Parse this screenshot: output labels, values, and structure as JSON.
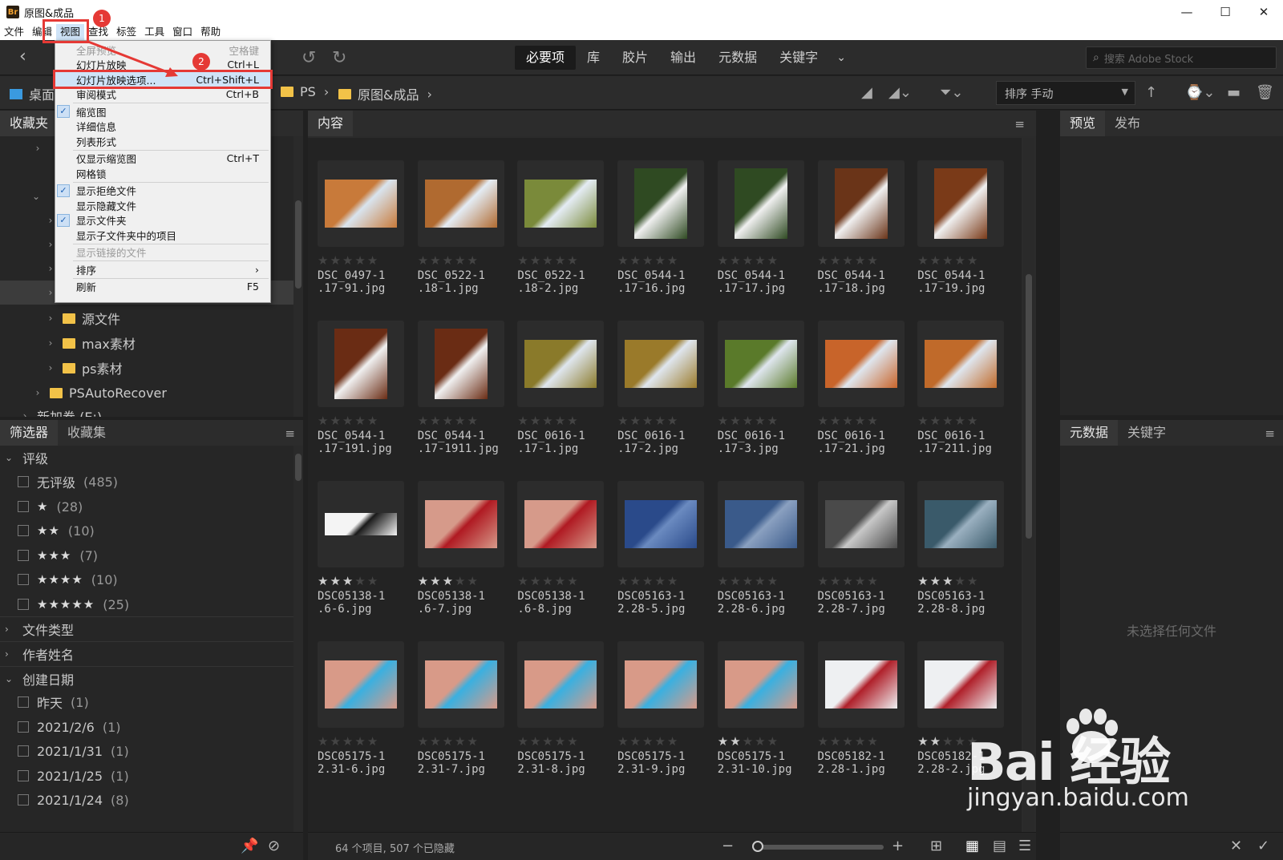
{
  "window": {
    "logo": "Br",
    "title": "原图&成品",
    "controls": [
      "—",
      "☐",
      "✕"
    ]
  },
  "menubar": [
    "文件",
    "编辑",
    "视图",
    "查找",
    "标签",
    "工具",
    "窗口",
    "帮助"
  ],
  "toolbar": {
    "workspaces": [
      "必要项",
      "库",
      "胶片",
      "输出",
      "元数据",
      "关键字"
    ],
    "more": "⌄",
    "search_placeholder": "搜索 Adobe Stock"
  },
  "path": {
    "desktop": "桌面",
    "ps": "PS",
    "current": "原图&成品",
    "sort_label": "排序 手动"
  },
  "left_top": {
    "tabs": [
      "收藏夹"
    ],
    "folders": [
      {
        "label": "源文件",
        "chev": "›",
        "indent": 56
      },
      {
        "label": "max素材",
        "chev": "›",
        "indent": 56
      },
      {
        "label": "ps素材",
        "chev": "›",
        "indent": 56
      },
      {
        "label": "PSAutoRecover",
        "chev": "›",
        "indent": 40
      },
      {
        "label": "新加卷 (E:)",
        "chev": "›",
        "indent": 24
      }
    ]
  },
  "filter": {
    "tabs": [
      "筛选器",
      "收藏集"
    ],
    "sections": {
      "rating": "评级",
      "file_type": "文件类型",
      "author": "作者姓名",
      "created": "创建日期"
    },
    "ratings": [
      {
        "label": "无评级",
        "count": "(485)"
      },
      {
        "stars": "★",
        "count": "(28)"
      },
      {
        "stars": "★★",
        "count": "(10)"
      },
      {
        "stars": "★★★",
        "count": "(7)"
      },
      {
        "stars": "★★★★",
        "count": "(10)"
      },
      {
        "stars": "★★★★★",
        "count": "(25)"
      }
    ],
    "dates": [
      {
        "label": "昨天",
        "count": "(1)"
      },
      {
        "label": "2021/2/6",
        "count": "(1)"
      },
      {
        "label": "2021/1/31",
        "count": "(1)"
      },
      {
        "label": "2021/1/25",
        "count": "(1)"
      },
      {
        "label": "2021/1/24",
        "count": "(8)"
      }
    ]
  },
  "content": {
    "tab": "内容",
    "items": [
      {
        "name": "DSC_0497-1\n.17-91.jpg",
        "rating": 0,
        "c1": "#c87a3a",
        "c2": "#d9e4ee",
        "shape": "wide"
      },
      {
        "name": "DSC_0522-1\n.18-1.jpg",
        "rating": 0,
        "c1": "#b06a30",
        "c2": "#e4ecf4",
        "shape": "wide"
      },
      {
        "name": "DSC_0522-1\n.18-2.jpg",
        "rating": 0,
        "c1": "#7a8a3a",
        "c2": "#e4ecf4",
        "shape": "wide"
      },
      {
        "name": "DSC_0544-1\n.17-16.jpg",
        "rating": 0,
        "c1": "#2f4a22",
        "c2": "#f0f0f0",
        "shape": "tall"
      },
      {
        "name": "DSC_0544-1\n.17-17.jpg",
        "rating": 0,
        "c1": "#2f4a22",
        "c2": "#f0f0f0",
        "shape": "tall"
      },
      {
        "name": "DSC_0544-1\n.17-18.jpg",
        "rating": 0,
        "c1": "#6a3418",
        "c2": "#f0f0f0",
        "shape": "tall"
      },
      {
        "name": "DSC_0544-1\n.17-19.jpg",
        "rating": 0,
        "c1": "#7a3a18",
        "c2": "#f0f0f0",
        "shape": "tall"
      },
      {
        "name": "DSC_0544-1\n.17-191.jpg",
        "rating": 0,
        "c1": "#6a2c14",
        "c2": "#f0f0f0",
        "shape": "tall"
      },
      {
        "name": "DSC_0544-1\n.17-1911.jpg",
        "rating": 0,
        "c1": "#6a2c14",
        "c2": "#f0f0f0",
        "shape": "tall"
      },
      {
        "name": "DSC_0616-1\n.17-1.jpg",
        "rating": 0,
        "c1": "#8a7a2a",
        "c2": "#dfe6ee",
        "shape": "wide"
      },
      {
        "name": "DSC_0616-1\n.17-2.jpg",
        "rating": 0,
        "c1": "#9a7a2a",
        "c2": "#dfe6ee",
        "shape": "wide"
      },
      {
        "name": "DSC_0616-1\n.17-3.jpg",
        "rating": 0,
        "c1": "#5a7a2a",
        "c2": "#dfe6ee",
        "shape": "wide"
      },
      {
        "name": "DSC_0616-1\n.17-21.jpg",
        "rating": 0,
        "c1": "#c8642a",
        "c2": "#dfe6ee",
        "shape": "wide"
      },
      {
        "name": "DSC_0616-1\n.17-211.jpg",
        "rating": 0,
        "c1": "#c06a2a",
        "c2": "#dfe6ee",
        "shape": "wide"
      },
      {
        "name": "DSC05138-1\n.6-6.jpg",
        "rating": 3,
        "c1": "#f4f4f4",
        "c2": "#1a1a1a",
        "shape": "banner"
      },
      {
        "name": "DSC05138-1\n.6-7.jpg",
        "rating": 3,
        "c1": "#d69a8a",
        "c2": "#b01a22",
        "shape": "wide"
      },
      {
        "name": "DSC05138-1\n.6-8.jpg",
        "rating": 0,
        "c1": "#d69a8a",
        "c2": "#b01a22",
        "shape": "wide"
      },
      {
        "name": "DSC05163-1\n2.28-5.jpg",
        "rating": 0,
        "c1": "#2a4a8a",
        "c2": "#6a8ac0",
        "shape": "wide"
      },
      {
        "name": "DSC05163-1\n2.28-6.jpg",
        "rating": 0,
        "c1": "#3a5a8a",
        "c2": "#8aa0c0",
        "shape": "wide"
      },
      {
        "name": "DSC05163-1\n2.28-7.jpg",
        "rating": 0,
        "c1": "#4a4a4a",
        "c2": "#c8c8c8",
        "shape": "wide"
      },
      {
        "name": "DSC05163-1\n2.28-8.jpg",
        "rating": 3,
        "c1": "#3a5a6a",
        "c2": "#9ab0c0",
        "shape": "wide"
      },
      {
        "name": "DSC05175-1\n2.31-6.jpg",
        "rating": 0,
        "c1": "#d89a88",
        "c2": "#3ab0e0",
        "shape": "wide"
      },
      {
        "name": "DSC05175-1\n2.31-7.jpg",
        "rating": 0,
        "c1": "#d89a88",
        "c2": "#3ab0e0",
        "shape": "wide"
      },
      {
        "name": "DSC05175-1\n2.31-8.jpg",
        "rating": 0,
        "c1": "#d89a88",
        "c2": "#3ab0e0",
        "shape": "wide"
      },
      {
        "name": "DSC05175-1\n2.31-9.jpg",
        "rating": 0,
        "c1": "#d89a88",
        "c2": "#3ab0e0",
        "shape": "wide"
      },
      {
        "name": "DSC05175-1\n2.31-10.jpg",
        "rating": 2,
        "c1": "#d89a88",
        "c2": "#3ab0e0",
        "shape": "wide"
      },
      {
        "name": "DSC05182-1\n2.28-1.jpg",
        "rating": 0,
        "c1": "#eef0f2",
        "c2": "#b0202a",
        "shape": "wide"
      },
      {
        "name": "DSC05182-1\n2.28-2.jpg",
        "rating": 2,
        "c1": "#eef0f2",
        "c2": "#b0202a",
        "shape": "wide"
      }
    ],
    "status": "64 个项目, 507 个已隐藏"
  },
  "right": {
    "top_tabs": [
      "预览",
      "发布"
    ],
    "bottom_tabs": [
      "元数据",
      "关键字"
    ],
    "empty": "未选择任何文件"
  },
  "dropdown": {
    "items": [
      {
        "label": "全屏预览",
        "shortcut": "空格键",
        "disabled": true
      },
      {
        "label": "幻灯片放映",
        "shortcut": "Ctrl+L"
      },
      {
        "label": "幻灯片放映选项...",
        "shortcut": "Ctrl+Shift+L",
        "highlight": true
      },
      {
        "label": "审阅模式",
        "shortcut": "Ctrl+B"
      },
      {
        "sep": true
      },
      {
        "label": "缩览图",
        "check": true
      },
      {
        "label": "详细信息"
      },
      {
        "label": "列表形式"
      },
      {
        "sep": true
      },
      {
        "label": "仅显示缩览图",
        "shortcut": "Ctrl+T"
      },
      {
        "label": "网格锁"
      },
      {
        "sep": true
      },
      {
        "label": "显示拒绝文件",
        "check": true
      },
      {
        "label": "显示隐藏文件"
      },
      {
        "label": "显示文件夹",
        "check": true
      },
      {
        "label": "显示子文件夹中的项目"
      },
      {
        "sep": true
      },
      {
        "label": "显示链接的文件",
        "disabled": true
      },
      {
        "sep": true
      },
      {
        "label": "排序",
        "shortcut": "›"
      },
      {
        "sep": true
      },
      {
        "label": "刷新",
        "shortcut": "F5"
      }
    ]
  },
  "annotations": {
    "badge1": "1",
    "badge2": "2",
    "color": "#e53935"
  },
  "watermark": {
    "brand": "Bai 经验",
    "url": "jingyan.baidu.com"
  }
}
